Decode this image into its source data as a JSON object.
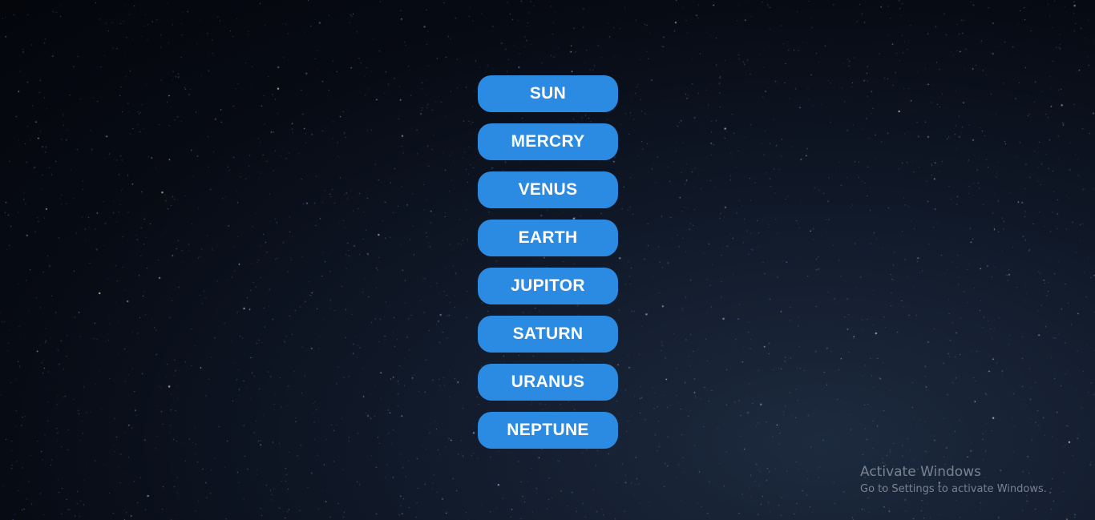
{
  "planets": [
    {
      "label": "SUN"
    },
    {
      "label": "MERCRY"
    },
    {
      "label": "VENUS"
    },
    {
      "label": "EARTH"
    },
    {
      "label": "JUPITOR"
    },
    {
      "label": "SATURN"
    },
    {
      "label": "URANUS"
    },
    {
      "label": "NEPTUNE"
    }
  ],
  "watermark": {
    "title": "Activate Windows",
    "subtitle": "Go to Settings to activate Windows."
  },
  "colors": {
    "button_background": "#2b8be3",
    "button_text": "#ffffff",
    "background": "#070b14"
  }
}
